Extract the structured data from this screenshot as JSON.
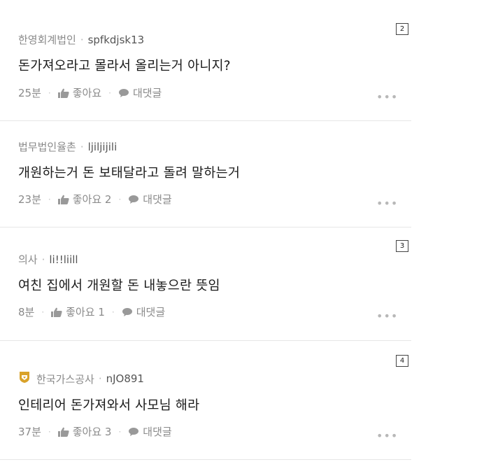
{
  "comments": [
    {
      "company": "한영회계법인",
      "username": "spfkdjsk13",
      "text": "돈가져오라고 몰라서 올리는거 아니지?",
      "time": "25분",
      "like_label": "좋아요",
      "reply_label": "대댓글",
      "badge": "2",
      "verified": false
    },
    {
      "company": "법무법인율촌",
      "username": "ljiljijili",
      "text": "개원하는거 돈 보태달라고 돌려 말하는거",
      "time": "23분",
      "like_label": "좋아요 2",
      "reply_label": "대댓글",
      "badge": "",
      "verified": false
    },
    {
      "company": "의사",
      "username": "li!!liill",
      "text": "여친 집에서 개원할 돈 내놓으란 뜻임",
      "time": "8분",
      "like_label": "좋아요 1",
      "reply_label": "대댓글",
      "badge": "3",
      "verified": false
    },
    {
      "company": "한국가스공사",
      "username": "nJO891",
      "text": "인테리어 돈가져와서 사모님 해라",
      "time": "37분",
      "like_label": "좋아요 3",
      "reply_label": "대댓글",
      "badge": "4",
      "verified": true
    }
  ],
  "separator_dot": "·",
  "more_label": "•••",
  "colors": {
    "verified_badge": "#d9a22a",
    "meta_text": "#8a8a8a",
    "divider": "#e6e6e6"
  }
}
